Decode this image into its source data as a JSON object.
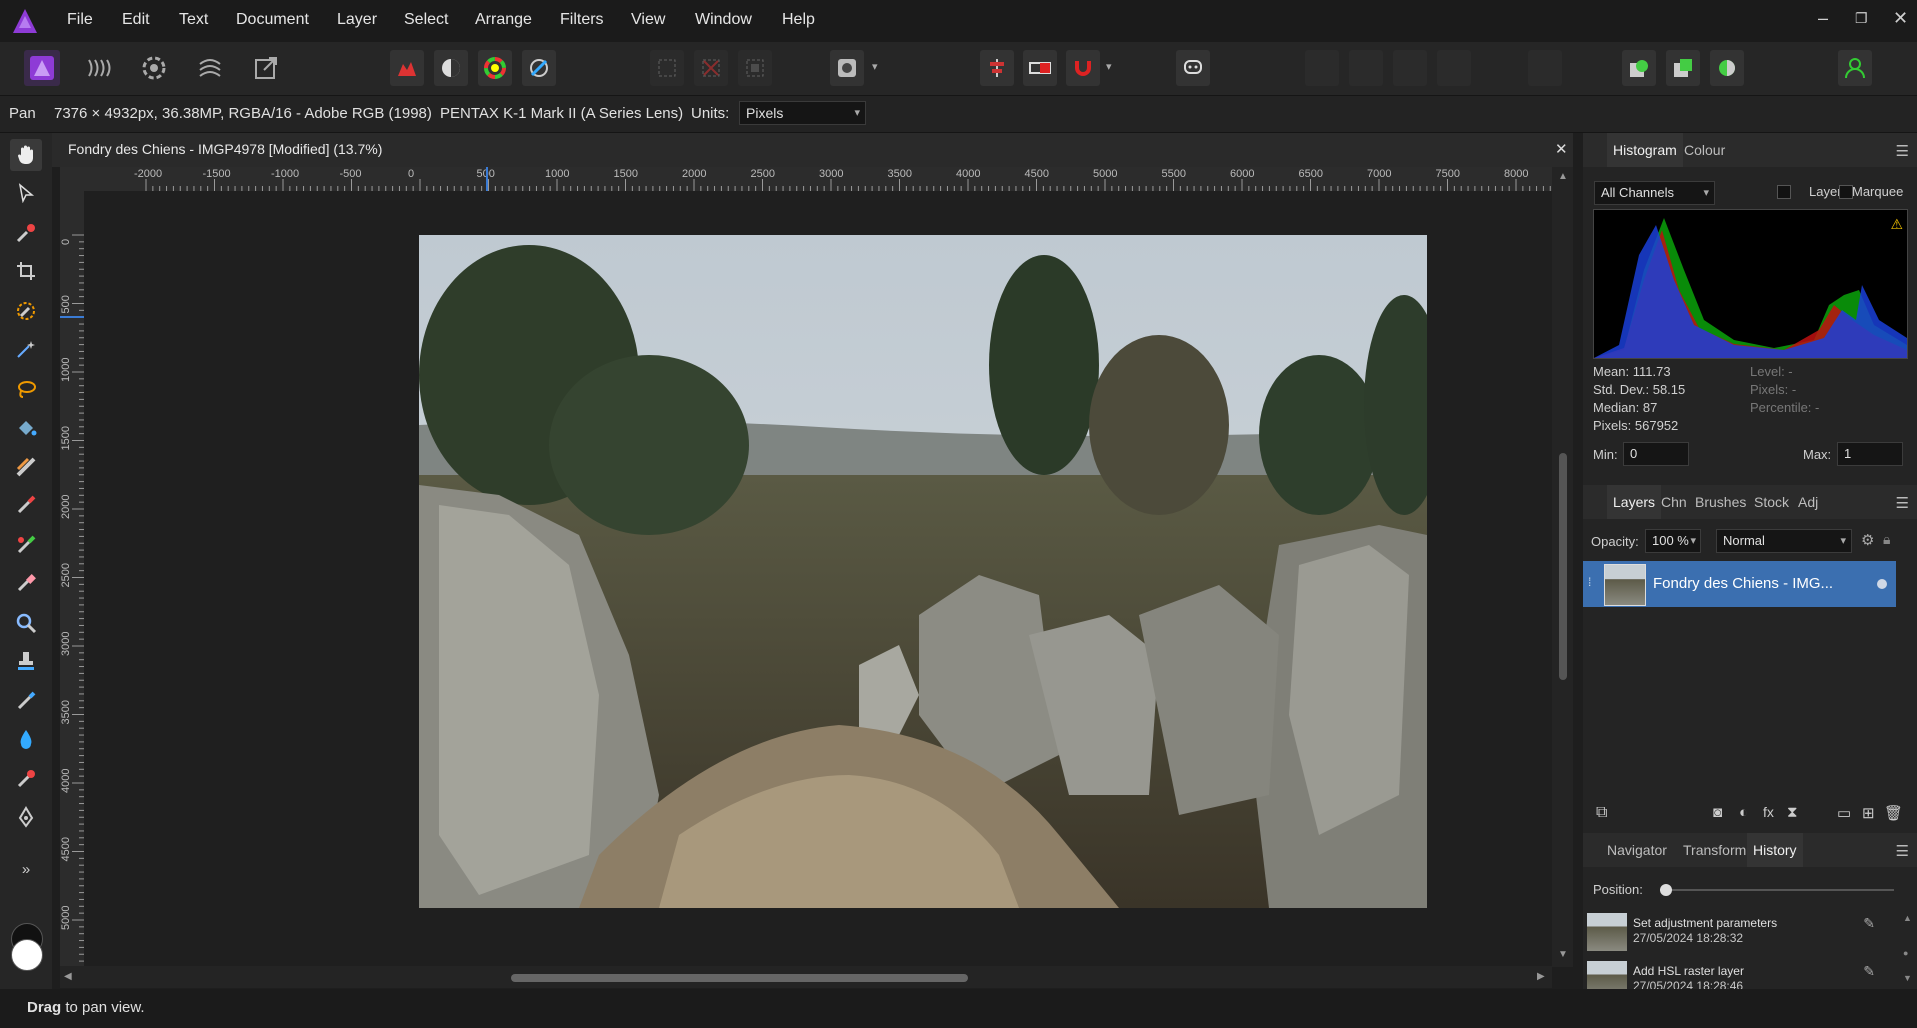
{
  "menubar": {
    "items": [
      "File",
      "Edit",
      "Text",
      "Document",
      "Layer",
      "Select",
      "Arrange",
      "Filters",
      "View",
      "Window",
      "Help"
    ],
    "window_controls": [
      "minimize",
      "restore",
      "close"
    ]
  },
  "context_bar": {
    "tool": "Pan",
    "doc_info": "7376 × 4932px, 36.38MP, RGBA/16 - Adobe RGB (1998)",
    "camera": "PENTAX K-1 Mark II (A Series Lens)",
    "units_label": "Units:",
    "units_value": "Pixels"
  },
  "document": {
    "tab_title": "Fondry des Chiens - IMGP4978 [Modified] (13.7%)",
    "close": "✕",
    "ruler_unit": "px",
    "hruler_labels": [
      "-2000",
      "-1500",
      "-1000",
      "-500",
      "0",
      "500",
      "1000",
      "1500",
      "2000",
      "2500",
      "3000",
      "3500",
      "4000",
      "4500",
      "5000",
      "5500",
      "6000",
      "6500",
      "7000",
      "7500",
      "8000"
    ],
    "vruler_labels": [
      "0",
      "500",
      "1000",
      "1500",
      "2000",
      "2500",
      "3000",
      "3500",
      "4000",
      "4500",
      "5000"
    ]
  },
  "status": {
    "bold": "Drag",
    "text": " to pan view."
  },
  "histogram_panel": {
    "tabs": [
      "Histogram",
      "Colour"
    ],
    "channel": "All Channels",
    "layer_label": "Layer",
    "marquee_label": "Marquee",
    "stats": {
      "mean": "Mean: 111.73",
      "stddev": "Std. Dev.: 58.15",
      "median": "Median: 87",
      "pixels": "Pixels: 567952",
      "level": "Level: -",
      "pixels_r": "Pixels: -",
      "percentile": "Percentile: -"
    },
    "min_label": "Min:",
    "min_value": "0",
    "max_label": "Max:",
    "max_value": "1"
  },
  "layers_panel": {
    "tabs": [
      "Layers",
      "Chn",
      "Brushes",
      "Stock",
      "Adj"
    ],
    "opacity_label": "Opacity:",
    "opacity_value": "100 %",
    "blend_mode": "Normal",
    "layer_name": "Fondry des Chiens - IMG..."
  },
  "history_panel": {
    "tabs": [
      "Navigator",
      "Transform",
      "History"
    ],
    "position_label": "Position:",
    "items": [
      {
        "title": "Set adjustment parameters",
        "time": "27/05/2024 18:28:32"
      },
      {
        "title": "Add HSL raster layer",
        "time": "27/05/2024 18:28:46"
      }
    ]
  },
  "colors": {
    "accent": "#3b6fb0",
    "app_bg": "#1e1e1e",
    "affinity_purple": "#8e3bd6"
  }
}
